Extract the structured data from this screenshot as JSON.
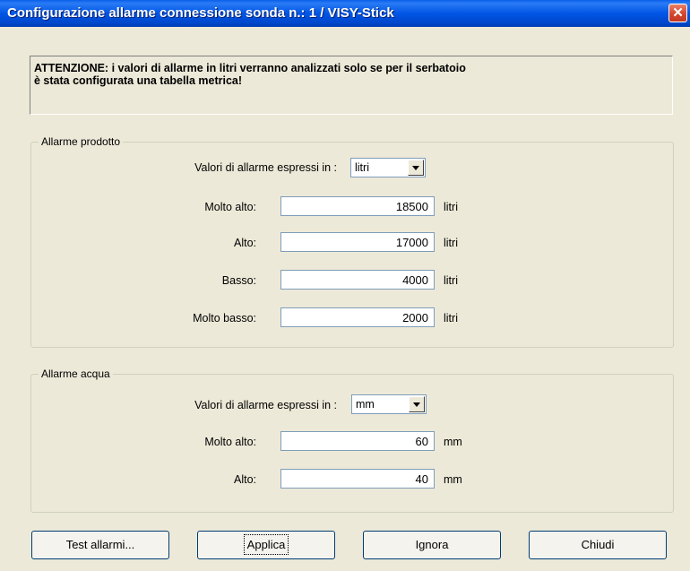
{
  "window": {
    "title": "Configurazione allarme connessione sonda n.: 1 / VISY-Stick",
    "close_glyph": "✕"
  },
  "warning": {
    "line1": "ATTENZIONE: i valori di allarme in litri verranno analizzati solo se per il serbatoio",
    "line2": "è stata configurata una tabella metrica!"
  },
  "product_group": {
    "legend": "Allarme prodotto",
    "units_label": "Valori di allarme espressi in :",
    "units_value": "litri",
    "rows": [
      {
        "label": "Molto alto:",
        "value": "18500",
        "unit": "litri"
      },
      {
        "label": "Alto:",
        "value": "17000",
        "unit": "litri"
      },
      {
        "label": "Basso:",
        "value": "4000",
        "unit": "litri"
      },
      {
        "label": "Molto basso:",
        "value": "2000",
        "unit": "litri"
      }
    ]
  },
  "water_group": {
    "legend": "Allarme acqua",
    "units_label": "Valori di allarme espressi in :",
    "units_value": "mm",
    "rows": [
      {
        "label": "Molto alto:",
        "value": "60",
        "unit": "mm"
      },
      {
        "label": "Alto:",
        "value": "40",
        "unit": "mm"
      }
    ]
  },
  "buttons": {
    "test": "Test allarmi...",
    "apply": "Applica",
    "ignore": "Ignora",
    "close": "Chiudi"
  },
  "colors": {
    "titlebar": "#0055E5",
    "dialog_bg": "#ECE9D8",
    "close_button": "#D5452B"
  }
}
